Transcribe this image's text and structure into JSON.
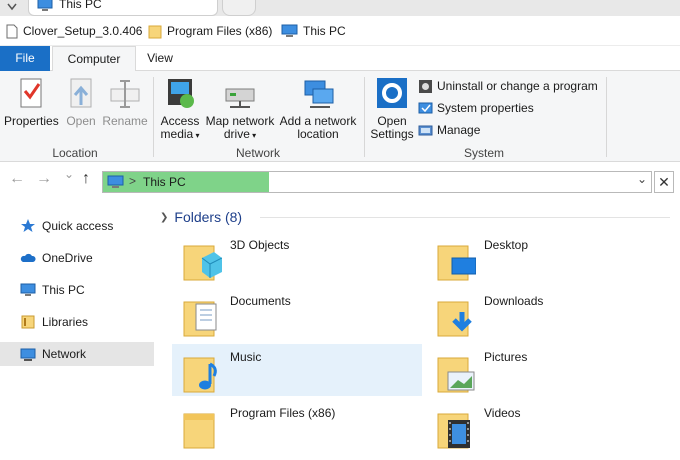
{
  "window": {
    "tab_title": "This PC"
  },
  "quick_bar": {
    "items": [
      "Clover_Setup_3.0.406",
      "Program Files (x86)",
      "This PC"
    ]
  },
  "ribbon": {
    "tabs": [
      "File",
      "Computer",
      "View"
    ],
    "location": {
      "label": "Location",
      "buttons": [
        "Properties",
        "Open",
        "Rename"
      ]
    },
    "network": {
      "label": "Network",
      "access_media": [
        "Access",
        "media"
      ],
      "map_drive": [
        "Map network",
        "drive"
      ],
      "add_location": [
        "Add a network",
        "location"
      ]
    },
    "system": {
      "label": "System",
      "open_settings": [
        "Open",
        "Settings"
      ],
      "items": [
        "Uninstall or change a program",
        "System properties",
        "Manage"
      ]
    }
  },
  "address_bar": {
    "path": "This PC",
    "separator": ">",
    "close_glyph": "✕",
    "back_glyph": "←",
    "forward_glyph": "→",
    "recent_glyph": "⌄",
    "up_glyph": "↑",
    "dropdown_glyph": "⌄"
  },
  "nav_pane": {
    "items": [
      "Quick access",
      "OneDrive",
      "This PC",
      "Libraries",
      "Network"
    ],
    "selected": "Network"
  },
  "content": {
    "group_title": "Folders (8)",
    "group_chevron": "❯",
    "folders": [
      "3D Objects",
      "Desktop",
      "Documents",
      "Downloads",
      "Music",
      "Pictures",
      "Program Files (x86)",
      "Videos"
    ],
    "selected": "Music"
  },
  "colors": {
    "file_tab": "#1a6fc6",
    "folder_yellow": "#f7d57a",
    "selection": "#e5f1fb",
    "address_highlight": "#7fd389",
    "group_heading": "#1e3f8a"
  }
}
